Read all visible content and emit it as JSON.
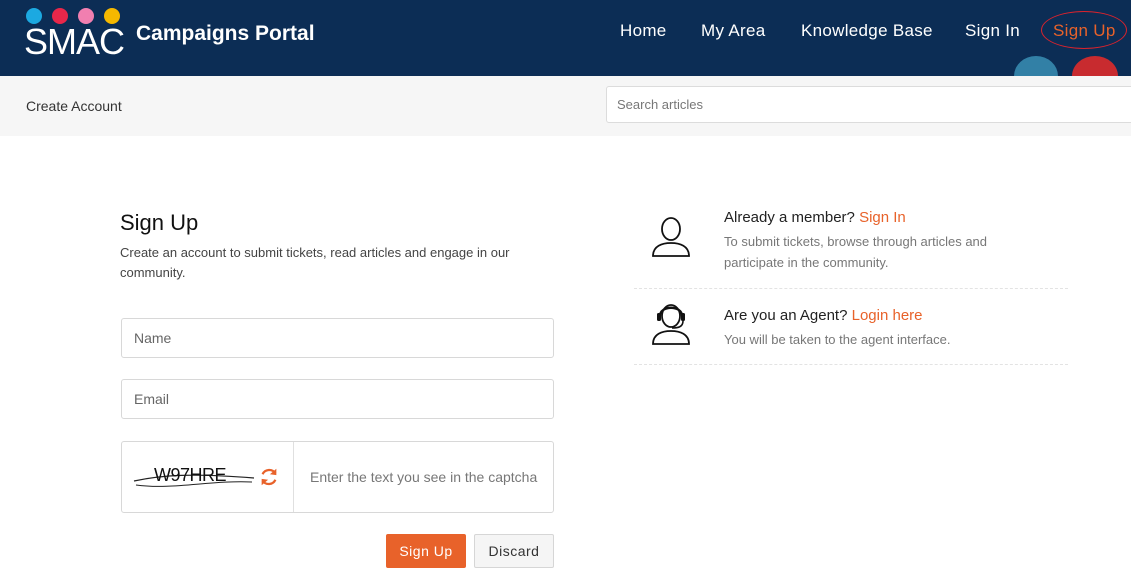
{
  "colors": {
    "header_bg": "#0c2d55",
    "accent": "#e8622a",
    "dot1": "#1ca9e1",
    "dot2": "#e8274a",
    "dot3": "#f17fb0",
    "dot4": "#f5b800"
  },
  "header": {
    "logo_text": "SMAC",
    "portal_title": "Campaigns Portal",
    "nav": {
      "home": "Home",
      "my_area": "My Area",
      "knowledge_base": "Knowledge Base",
      "sign_in": "Sign In",
      "sign_up": "Sign Up"
    }
  },
  "subheader": {
    "breadcrumb": "Create Account",
    "search_placeholder": "Search articles"
  },
  "form": {
    "title": "Sign Up",
    "subtitle": "Create an account to submit tickets, read articles and engage in our community.",
    "name_placeholder": "Name",
    "email_placeholder": "Email",
    "captcha_text": "W97HRE",
    "captcha_placeholder": "Enter the text you see in the captcha",
    "submit_label": "Sign Up",
    "discard_label": "Discard"
  },
  "side": {
    "member": {
      "prompt": "Already a member?",
      "link": "Sign In",
      "desc": "To submit tickets, browse through articles and participate in the community.",
      "icon": "user-icon"
    },
    "agent": {
      "prompt": "Are you an Agent?",
      "link": "Login here",
      "desc": "You will be taken to the agent interface.",
      "icon": "headset-agent-icon"
    }
  }
}
